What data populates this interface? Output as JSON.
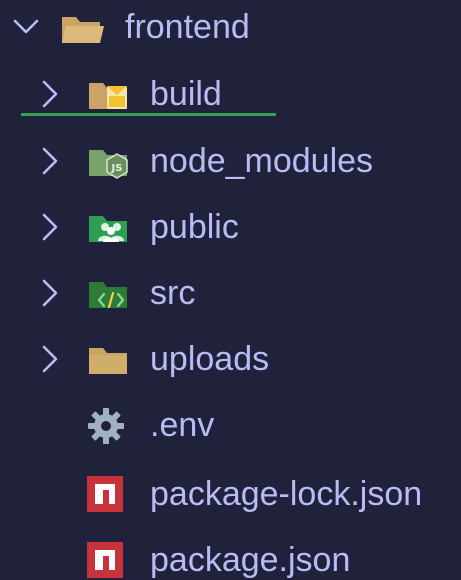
{
  "explorer": {
    "root": {
      "label": "frontend",
      "icon": "folder-open-icon",
      "expanded": true
    },
    "items": [
      {
        "label": "build",
        "type": "folder",
        "icon": "folder-build-icon",
        "expanded": false
      },
      {
        "label": "node_modules",
        "type": "folder",
        "icon": "folder-node-icon",
        "expanded": false
      },
      {
        "label": "public",
        "type": "folder",
        "icon": "folder-public-icon",
        "expanded": false
      },
      {
        "label": "src",
        "type": "folder",
        "icon": "folder-src-icon",
        "expanded": false
      },
      {
        "label": "uploads",
        "type": "folder",
        "icon": "folder-icon",
        "expanded": false
      },
      {
        "label": ".env",
        "type": "file",
        "icon": "gear-icon"
      },
      {
        "label": "package-lock.json",
        "type": "file",
        "icon": "npm-icon"
      },
      {
        "label": "package.json",
        "type": "file",
        "icon": "npm-icon"
      }
    ]
  },
  "colors": {
    "background": "#20213a",
    "label": "#b9bbf5",
    "chevron": "#b9bbf5",
    "folder": "#c9a464",
    "node_folder": "#79a26a",
    "public_folder": "#2f9e52",
    "src_folder": "#2f7a37",
    "build_badge": "#f2c230",
    "gear": "#9fb1c2",
    "npm": "#c8323a",
    "active_underline": "#2fa44b"
  }
}
